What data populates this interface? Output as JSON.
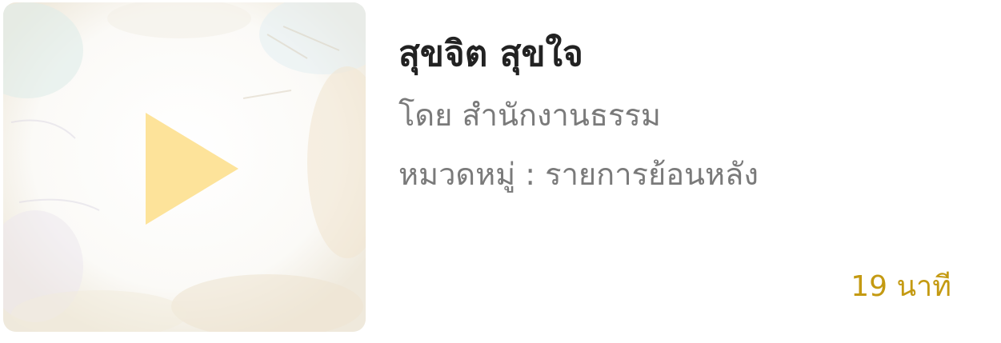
{
  "episode": {
    "title": "สุขจิต สุขใจ",
    "author": "โดย สำนักงานธรรม",
    "category": "หมวดหมู่ : รายการย้อนหลัง",
    "duration": "19 นาที"
  },
  "thumbnail": {
    "icon": "play-icon"
  },
  "colors": {
    "title": "#222222",
    "meta": "#7a7a7a",
    "duration": "#c49a12",
    "play": "#fde39a"
  }
}
